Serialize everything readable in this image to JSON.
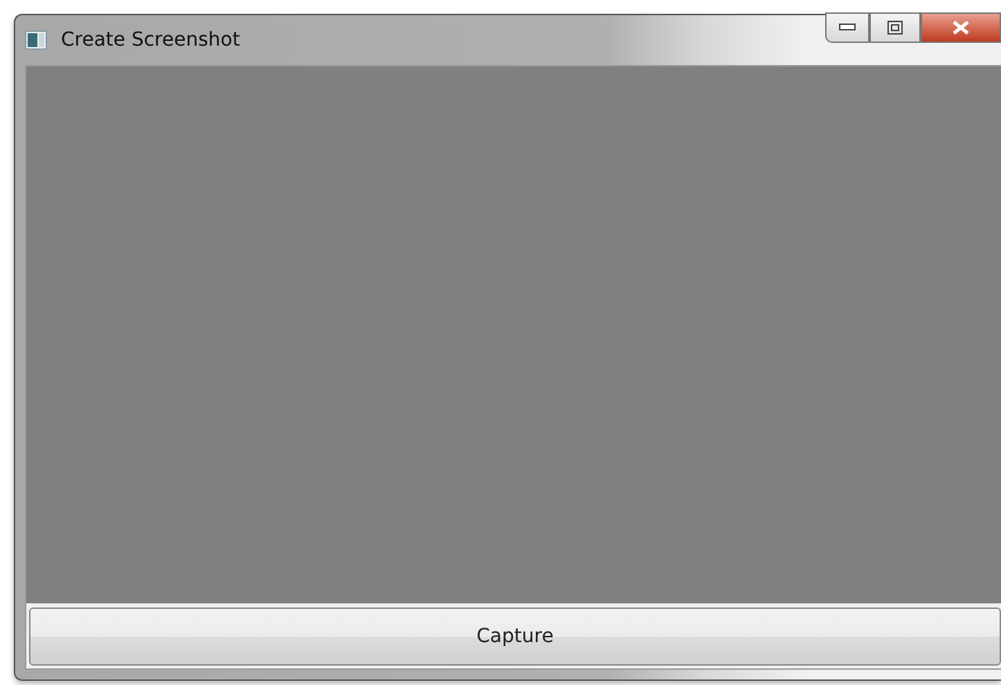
{
  "window": {
    "title": "Create Screenshot"
  },
  "buttons": [
    "Capture"
  ]
}
